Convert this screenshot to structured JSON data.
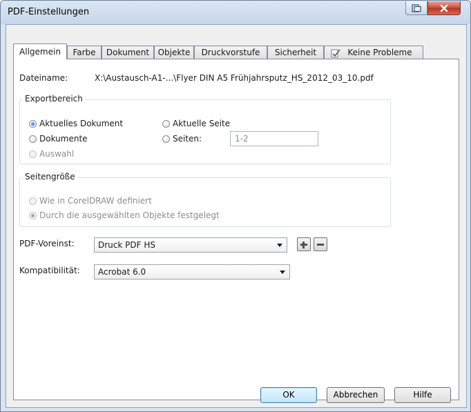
{
  "window": {
    "title": "PDF-Einstellungen"
  },
  "tabs": [
    {
      "label": "Allgemein",
      "active": true
    },
    {
      "label": "Farbe"
    },
    {
      "label": "Dokument"
    },
    {
      "label": "Objekte"
    },
    {
      "label": "Druckvorstufe"
    },
    {
      "label": "Sicherheit"
    },
    {
      "label": "Keine Probleme",
      "icon": "check-document-icon"
    }
  ],
  "general": {
    "filename_label": "Dateiname:",
    "filename_value": "X:\\Austausch-A1-...\\Flyer DIN A5 Frühjahrsputz_HS_2012_03_10.pdf"
  },
  "export_range": {
    "title": "Exportbereich",
    "current_document": "Aktuelles Dokument",
    "documents": "Dokumente",
    "selection": "Auswahl",
    "current_page": "Aktuelle Seite",
    "pages": "Seiten:",
    "pages_value": "1-2",
    "selected": "current_document"
  },
  "page_size": {
    "title": "Seitengröße",
    "as_defined": "Wie in CorelDRAW definiert",
    "by_objects": "Durch die ausgewählten Objekte festgelegt"
  },
  "preset": {
    "label": "PDF-Voreinst:",
    "value": "Druck PDF HS",
    "add_icon": "plus-icon",
    "remove_icon": "minus-icon"
  },
  "compatibility": {
    "label": "Kompatibilität:",
    "value": "Acrobat 6.0"
  },
  "buttons": {
    "ok": "OK",
    "cancel": "Abbrechen",
    "help": "Hilfe"
  },
  "colors": {
    "close_button": "#c74e3c",
    "default_button": "#bee6fd",
    "radio_checked": "#1f5fd1"
  }
}
